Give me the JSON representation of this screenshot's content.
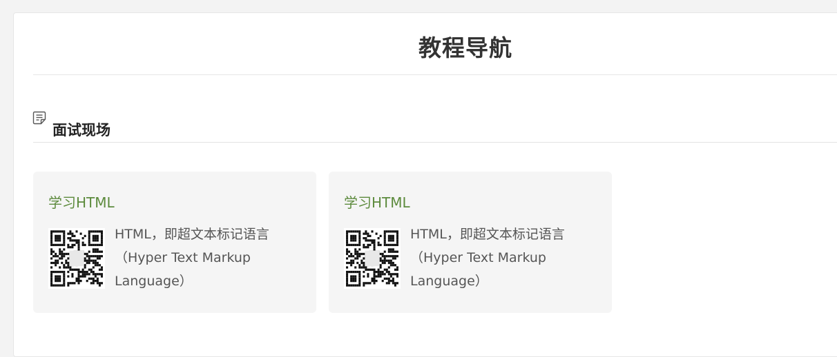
{
  "page": {
    "title": "教程导航"
  },
  "section": {
    "title": "面试现场",
    "icon": "document-edit-icon"
  },
  "cards": [
    {
      "title": "学习HTML",
      "description": "HTML，即超文本标记语言（Hyper Text Markup Language）",
      "image": "qr-code"
    },
    {
      "title": "学习HTML",
      "description": "HTML，即超文本标记语言（Hyper Text Markup Language）",
      "image": "qr-code"
    }
  ],
  "colors": {
    "card_title": "#5c8a3c",
    "card_background": "#f5f5f5",
    "page_background": "#f3f3f3"
  }
}
